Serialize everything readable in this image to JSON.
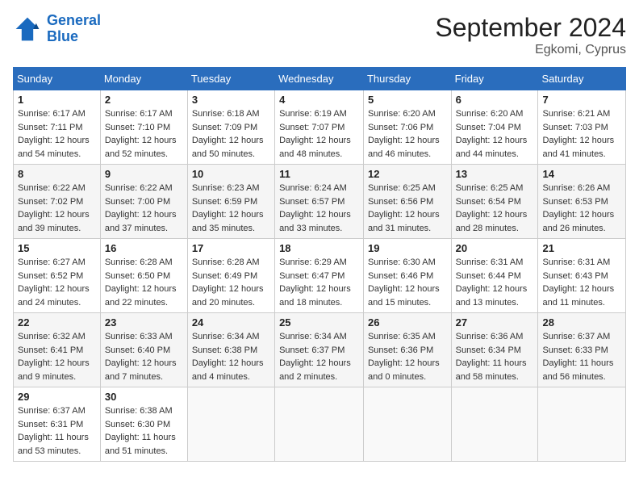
{
  "header": {
    "logo_line1": "General",
    "logo_line2": "Blue",
    "month_title": "September 2024",
    "location": "Egkomi, Cyprus"
  },
  "weekdays": [
    "Sunday",
    "Monday",
    "Tuesday",
    "Wednesday",
    "Thursday",
    "Friday",
    "Saturday"
  ],
  "weeks": [
    [
      {
        "day": "1",
        "sunrise": "6:17 AM",
        "sunset": "7:11 PM",
        "daylight": "12 hours and 54 minutes."
      },
      {
        "day": "2",
        "sunrise": "6:17 AM",
        "sunset": "7:10 PM",
        "daylight": "12 hours and 52 minutes."
      },
      {
        "day": "3",
        "sunrise": "6:18 AM",
        "sunset": "7:09 PM",
        "daylight": "12 hours and 50 minutes."
      },
      {
        "day": "4",
        "sunrise": "6:19 AM",
        "sunset": "7:07 PM",
        "daylight": "12 hours and 48 minutes."
      },
      {
        "day": "5",
        "sunrise": "6:20 AM",
        "sunset": "7:06 PM",
        "daylight": "12 hours and 46 minutes."
      },
      {
        "day": "6",
        "sunrise": "6:20 AM",
        "sunset": "7:04 PM",
        "daylight": "12 hours and 44 minutes."
      },
      {
        "day": "7",
        "sunrise": "6:21 AM",
        "sunset": "7:03 PM",
        "daylight": "12 hours and 41 minutes."
      }
    ],
    [
      {
        "day": "8",
        "sunrise": "6:22 AM",
        "sunset": "7:02 PM",
        "daylight": "12 hours and 39 minutes."
      },
      {
        "day": "9",
        "sunrise": "6:22 AM",
        "sunset": "7:00 PM",
        "daylight": "12 hours and 37 minutes."
      },
      {
        "day": "10",
        "sunrise": "6:23 AM",
        "sunset": "6:59 PM",
        "daylight": "12 hours and 35 minutes."
      },
      {
        "day": "11",
        "sunrise": "6:24 AM",
        "sunset": "6:57 PM",
        "daylight": "12 hours and 33 minutes."
      },
      {
        "day": "12",
        "sunrise": "6:25 AM",
        "sunset": "6:56 PM",
        "daylight": "12 hours and 31 minutes."
      },
      {
        "day": "13",
        "sunrise": "6:25 AM",
        "sunset": "6:54 PM",
        "daylight": "12 hours and 28 minutes."
      },
      {
        "day": "14",
        "sunrise": "6:26 AM",
        "sunset": "6:53 PM",
        "daylight": "12 hours and 26 minutes."
      }
    ],
    [
      {
        "day": "15",
        "sunrise": "6:27 AM",
        "sunset": "6:52 PM",
        "daylight": "12 hours and 24 minutes."
      },
      {
        "day": "16",
        "sunrise": "6:28 AM",
        "sunset": "6:50 PM",
        "daylight": "12 hours and 22 minutes."
      },
      {
        "day": "17",
        "sunrise": "6:28 AM",
        "sunset": "6:49 PM",
        "daylight": "12 hours and 20 minutes."
      },
      {
        "day": "18",
        "sunrise": "6:29 AM",
        "sunset": "6:47 PM",
        "daylight": "12 hours and 18 minutes."
      },
      {
        "day": "19",
        "sunrise": "6:30 AM",
        "sunset": "6:46 PM",
        "daylight": "12 hours and 15 minutes."
      },
      {
        "day": "20",
        "sunrise": "6:31 AM",
        "sunset": "6:44 PM",
        "daylight": "12 hours and 13 minutes."
      },
      {
        "day": "21",
        "sunrise": "6:31 AM",
        "sunset": "6:43 PM",
        "daylight": "12 hours and 11 minutes."
      }
    ],
    [
      {
        "day": "22",
        "sunrise": "6:32 AM",
        "sunset": "6:41 PM",
        "daylight": "12 hours and 9 minutes."
      },
      {
        "day": "23",
        "sunrise": "6:33 AM",
        "sunset": "6:40 PM",
        "daylight": "12 hours and 7 minutes."
      },
      {
        "day": "24",
        "sunrise": "6:34 AM",
        "sunset": "6:38 PM",
        "daylight": "12 hours and 4 minutes."
      },
      {
        "day": "25",
        "sunrise": "6:34 AM",
        "sunset": "6:37 PM",
        "daylight": "12 hours and 2 minutes."
      },
      {
        "day": "26",
        "sunrise": "6:35 AM",
        "sunset": "6:36 PM",
        "daylight": "12 hours and 0 minutes."
      },
      {
        "day": "27",
        "sunrise": "6:36 AM",
        "sunset": "6:34 PM",
        "daylight": "11 hours and 58 minutes."
      },
      {
        "day": "28",
        "sunrise": "6:37 AM",
        "sunset": "6:33 PM",
        "daylight": "11 hours and 56 minutes."
      }
    ],
    [
      {
        "day": "29",
        "sunrise": "6:37 AM",
        "sunset": "6:31 PM",
        "daylight": "11 hours and 53 minutes."
      },
      {
        "day": "30",
        "sunrise": "6:38 AM",
        "sunset": "6:30 PM",
        "daylight": "11 hours and 51 minutes."
      },
      null,
      null,
      null,
      null,
      null
    ]
  ]
}
